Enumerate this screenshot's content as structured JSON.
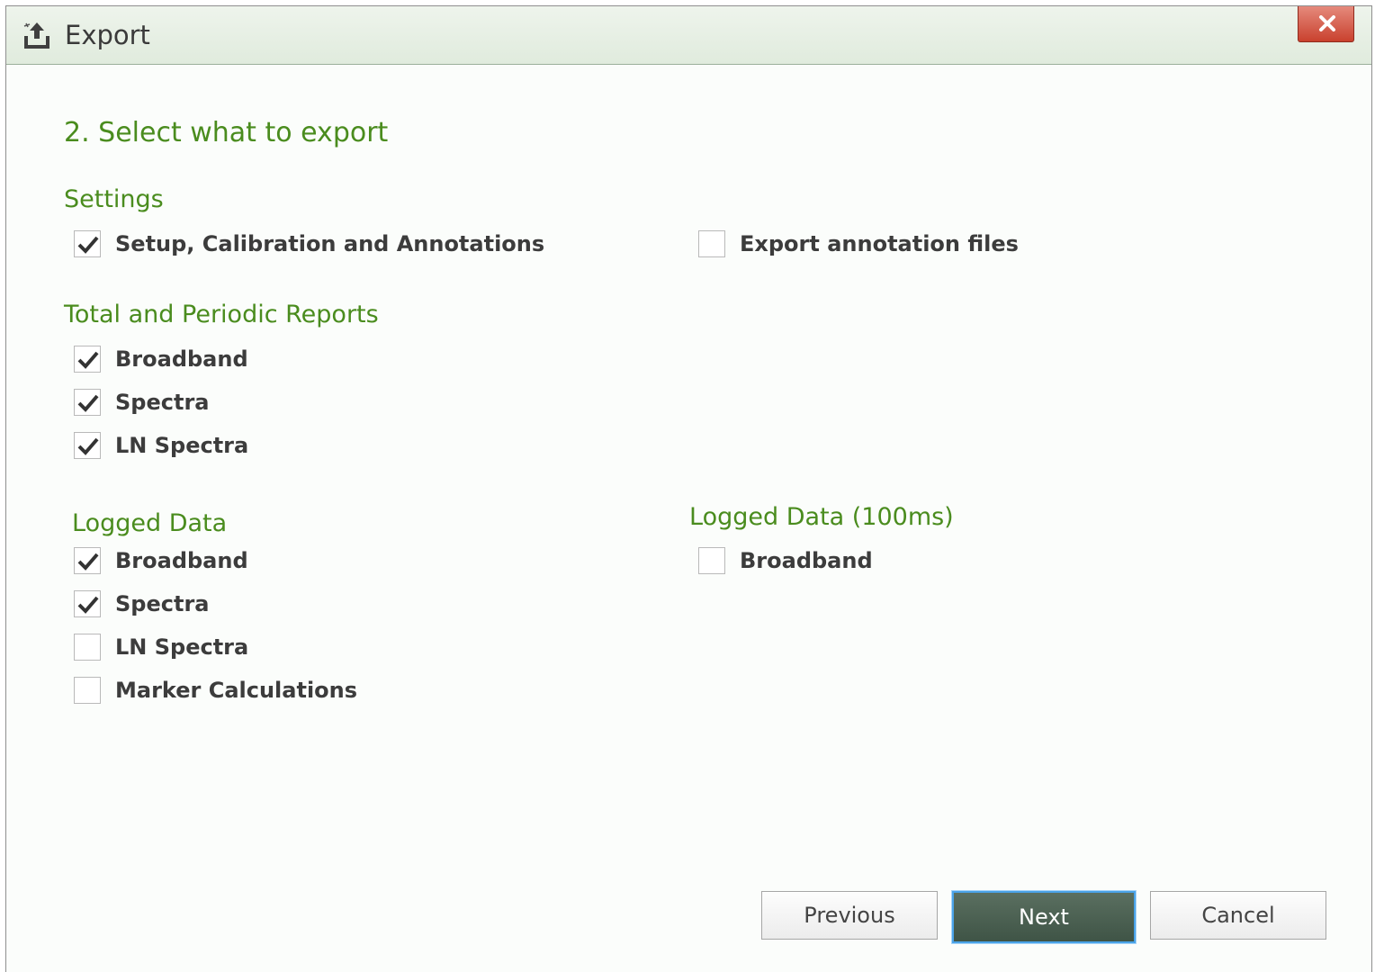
{
  "window": {
    "title": "Export",
    "title_icon": "export-icon",
    "close_icon": "close-icon"
  },
  "step": {
    "heading": "2. Select what to export"
  },
  "settings": {
    "title": "Settings",
    "items": [
      {
        "label": "Setup, Calibration and Annotations",
        "checked": true
      },
      {
        "label": "Export annotation files",
        "checked": false
      }
    ]
  },
  "reports": {
    "title": "Total and Periodic Reports",
    "items": [
      {
        "label": "Broadband",
        "checked": true
      },
      {
        "label": "Spectra",
        "checked": true
      },
      {
        "label": "LN Spectra",
        "checked": true
      }
    ]
  },
  "logged": {
    "title": "Logged Data",
    "items": [
      {
        "label": "Broadband",
        "checked": true
      },
      {
        "label": "Spectra",
        "checked": true
      },
      {
        "label": "LN Spectra",
        "checked": false
      },
      {
        "label": "Marker Calculations",
        "checked": false
      }
    ]
  },
  "logged100": {
    "title": "Logged Data (100ms)",
    "items": [
      {
        "label": "Broadband",
        "checked": false
      }
    ]
  },
  "buttons": {
    "previous": "Previous",
    "next": "Next",
    "cancel": "Cancel"
  },
  "colors": {
    "accent_green": "#4a8c1e",
    "close_red": "#c9412e",
    "primary_button": "#4f6455"
  }
}
